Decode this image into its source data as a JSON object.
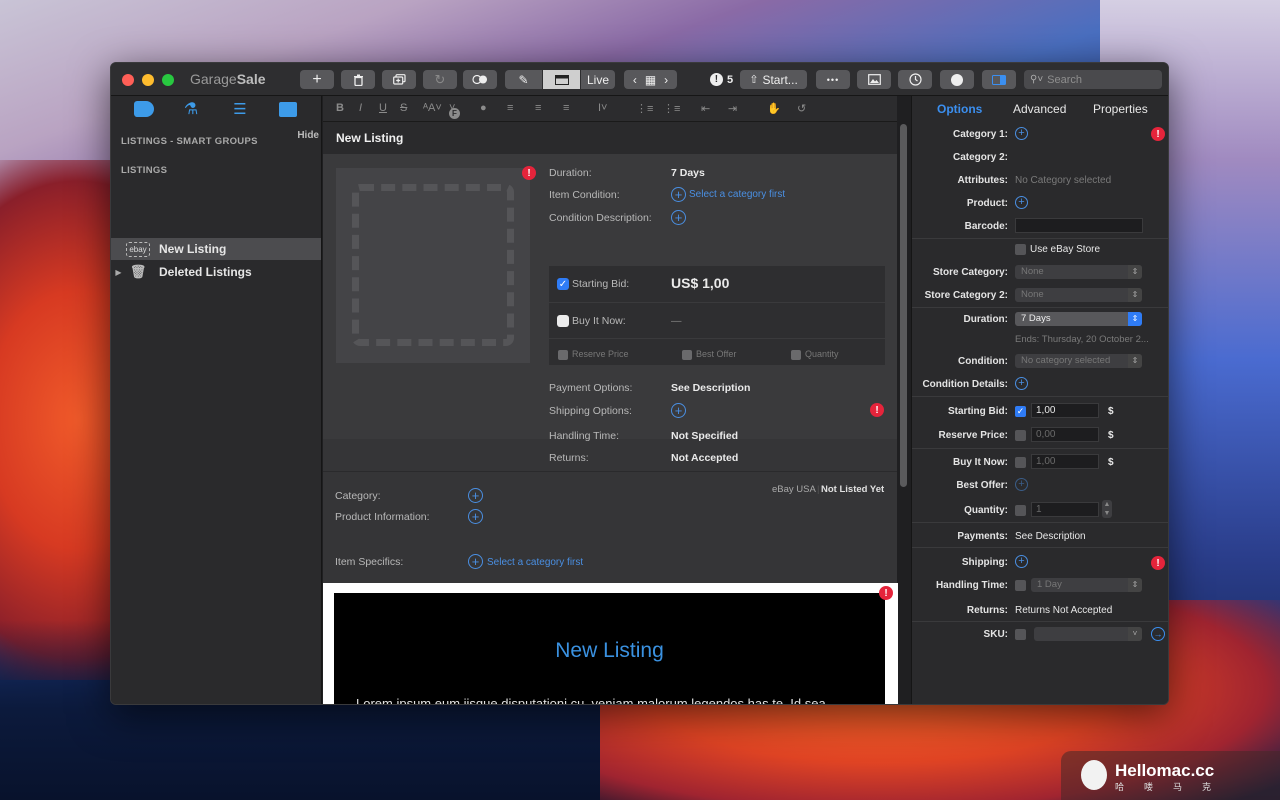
{
  "app": {
    "title_light": "Garage",
    "title_bold": "Sale"
  },
  "toolbar": {
    "live_label": "Live",
    "alerts_count": "5",
    "start_label": "Start...",
    "more_label": "•••",
    "search_placeholder": "Search"
  },
  "sidebar": {
    "smart_groups_label": "LISTINGS - SMART GROUPS",
    "hide_label": "Hide",
    "listings_label": "LISTINGS",
    "badge": "ebay",
    "items": [
      {
        "label": "New Listing",
        "selected": true
      },
      {
        "label": "Deleted Listings",
        "selected": false
      }
    ]
  },
  "format_bar": {
    "bold": "B",
    "italic": "I",
    "underline": "U",
    "strike": "S",
    "font_size": "ᴬA",
    "font": "F"
  },
  "listing": {
    "title": "New Listing",
    "duration_label": "Duration:",
    "duration_value": "7 Days",
    "condition_label": "Item Condition:",
    "condition_link": "Select a category first",
    "condition_desc_label": "Condition Description:",
    "starting_bid_label": "Starting Bid:",
    "starting_bid_value": "US$ 1,00",
    "buy_it_now_label": "Buy It Now:",
    "buy_it_now_value": "—",
    "reserve_price_label": "Reserve Price",
    "best_offer_label": "Best Offer",
    "quantity_label": "Quantity",
    "payment_label": "Payment Options:",
    "payment_value": "See Description",
    "shipping_label": "Shipping Options:",
    "handling_label": "Handling Time:",
    "handling_value": "Not Specified",
    "returns_label": "Returns:",
    "returns_value": "Not Accepted",
    "category_label": "Category:",
    "product_info_label": "Product Information:",
    "item_specifics_label": "Item Specifics:",
    "item_specifics_link": "Select a category first",
    "site": "eBay USA",
    "status": "Not Listed Yet",
    "warn_mark": "!"
  },
  "preview": {
    "title": "New Listing",
    "body": "Lorem ipsum eum iisque disputationi cu, veniam malorum legendos has te. Id sea aeque viderer, qui ad eruditi adversarium. An eum sonet impedit. Pro ex diam debet deseruisse. Ei quot postea dolorum est, ex minim ludus vivendum mei."
  },
  "inspector": {
    "tabs": [
      {
        "label": "Options",
        "active": true
      },
      {
        "label": "Advanced",
        "active": false
      },
      {
        "label": "Properties",
        "active": false
      }
    ],
    "category1_label": "Category 1:",
    "category2_label": "Category 2:",
    "attributes_label": "Attributes:",
    "attributes_value": "No Category selected",
    "product_label": "Product:",
    "barcode_label": "Barcode:",
    "use_ebay_store_label": "Use eBay Store",
    "store_category_label": "Store Category:",
    "store_category_value": "None",
    "store_category2_label": "Store Category 2:",
    "store_category2_value": "None",
    "duration_label": "Duration:",
    "duration_value": "7 Days",
    "ends_text": "Ends: Thursday, 20 October 2...",
    "condition_label": "Condition:",
    "condition_value": "No category selected",
    "condition_details_label": "Condition Details:",
    "starting_bid_label": "Starting Bid:",
    "starting_bid_value": "1,00",
    "reserve_price_label": "Reserve Price:",
    "reserve_price_value": "0,00",
    "buy_it_now_label": "Buy It Now:",
    "buy_it_now_value": "1,00",
    "best_offer_label": "Best Offer:",
    "quantity_label": "Quantity:",
    "quantity_value": "1",
    "payments_label": "Payments:",
    "payments_value": "See Description",
    "shipping_label": "Shipping:",
    "handling_time_label": "Handling Time:",
    "handling_time_value": "1 Day",
    "returns_label": "Returns:",
    "returns_value": "Returns Not Accepted",
    "sku_label": "SKU:",
    "currency": "$"
  },
  "watermark": {
    "title": "Hellomac.cc",
    "subtitle": "哈喽马克"
  },
  "colors": {
    "accent": "#3b8ff0",
    "warning": "#e5243b"
  }
}
